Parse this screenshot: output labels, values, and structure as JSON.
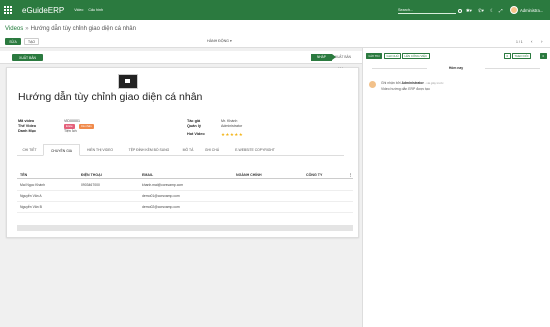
{
  "navbar": {
    "brand": "eGuideERP",
    "menu": [
      "Video",
      "Cấu hình"
    ],
    "search_placeholder": "Search...",
    "user": "Administra..."
  },
  "control_panel": {
    "breadcrumb": [
      "Videos",
      "Hướng dẫn tùy chỉnh giao diện cá nhân"
    ],
    "edit_label": "SỬA",
    "create_label": "TẠO",
    "action_label": "HÀNH ĐỘNG ▾",
    "publish_label": "XUẤT BẢN",
    "pager": "1 / 1"
  },
  "statusbar": {
    "stages": [
      "NHÁP",
      "XUẤT BẢN"
    ],
    "active_stage": "NHÁP"
  },
  "record": {
    "title": "Hướng dẫn tùy chỉnh giao diện cá nhân",
    "fields_left": [
      {
        "label": "Mã video",
        "value": "VID00001"
      },
      {
        "label": "Thể Video",
        "value": ""
      },
      {
        "label": "Danh Mục",
        "value": "Tiện Ích"
      }
    ],
    "badges": [
      {
        "text": "Erste",
        "color": "#e4607a"
      },
      {
        "text": "Cá nhân",
        "color": "#f08a4b"
      }
    ],
    "fields_right": [
      {
        "label": "Tác giả",
        "value": "Mr. Khánh"
      },
      {
        "label": "Quản lý",
        "value": "Administrator"
      },
      {
        "label": "Hot Video",
        "value": ""
      }
    ],
    "rating_stars": "★★★★★"
  },
  "tabs": [
    "CHI TIẾT",
    "CHUYÊN GIA",
    "HIỂN THỊ VIDEO",
    "TỆP ĐÍNH KÈM BỔ SUNG",
    "MÔ TẢ",
    "GHI CHÚ",
    "E-WEBSITE COPYRIGHT"
  ],
  "active_tab": "CHUYÊN GIA",
  "table": {
    "headers": [
      "TÊN",
      "ĐIỆN THOẠI",
      "EMAIL",
      "NGÀNH CHÍNH",
      "CÔNG TY"
    ],
    "rows": [
      [
        "Mai Ngọc Khánh",
        "0903467000",
        "khanh.mai@corsvamp.com",
        "",
        ""
      ],
      [
        "Nguyễn Văn A",
        "",
        "demo01@corsvamp.com",
        "",
        ""
      ],
      [
        "Nguyễn Văn B",
        "",
        "demo02@corsvamp.com",
        "",
        ""
      ]
    ]
  },
  "chatter": {
    "buttons": [
      "GỬI TIN",
      "GHI CHÚ",
      "LÊN CÔNG VIỆC"
    ],
    "followers": "0",
    "follow_label": "THEO DÕI",
    "attach_count": "0",
    "date_label": "Hôm nay",
    "message": {
      "author": "Administrator",
      "prefix": "Ghi nhận bởi",
      "meta": "- vài giây trước",
      "body": "Video hướng dẫn ERP được tạo"
    }
  }
}
